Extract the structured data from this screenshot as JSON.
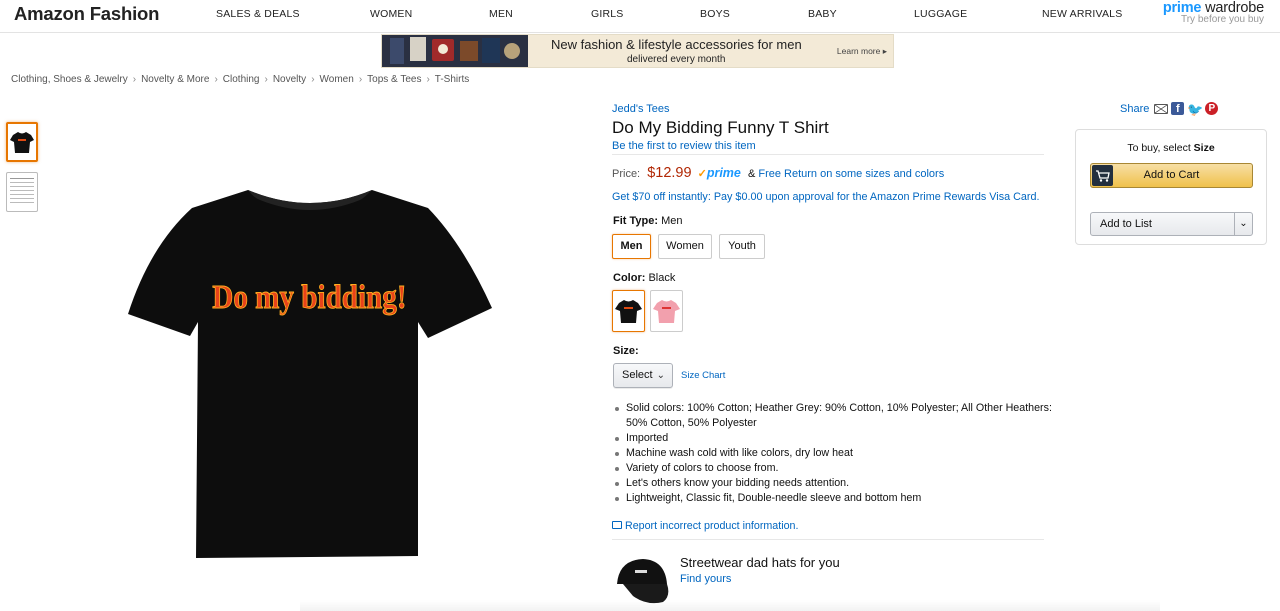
{
  "brand": "Amazon Fashion",
  "nav": {
    "items": [
      "SALES & DEALS",
      "WOMEN",
      "MEN",
      "GIRLS",
      "BOYS",
      "BABY",
      "LUGGAGE",
      "NEW ARRIVALS"
    ]
  },
  "prime_wardrobe": {
    "prime": "prime",
    "wardrobe": " wardrobe",
    "sub": "Try before you buy"
  },
  "banner": {
    "headline": "New fashion & lifestyle accessories for men",
    "sub": "delivered every month",
    "learn_more": "Learn more ▸"
  },
  "breadcrumb": [
    "Clothing, Shoes & Jewelry",
    "Novelty & More",
    "Clothing",
    "Novelty",
    "Women",
    "Tops & Tees",
    "T-Shirts"
  ],
  "breadcrumb_sep": "›",
  "product": {
    "byline": "Jedd's Tees",
    "title": "Do My Bidding Funny T Shirt",
    "review_link": "Be the first to review this item",
    "price_label": "Price:",
    "price": "$12.99",
    "prime_logo": "prime",
    "prime_check": "✓",
    "amp": "&",
    "free_return": "Free Return on some sizes and colors",
    "promo": "Get $70 off instantly: Pay $0.00 upon approval for the Amazon Prime Rewards Visa Card.",
    "shirt_print": "Do my bidding!"
  },
  "fit": {
    "label": "Fit Type:",
    "value": "Men",
    "options": [
      "Men",
      "Women",
      "Youth"
    ]
  },
  "color": {
    "label": "Color:",
    "value": "Black",
    "swatches": [
      "Black",
      "Pink"
    ]
  },
  "size": {
    "label": "Size:",
    "select": "Select",
    "chart": "Size Chart"
  },
  "bullets": [
    "Solid colors: 100% Cotton; Heather Grey: 90% Cotton, 10% Polyester; All Other Heathers: 50% Cotton, 50% Polyester",
    "Imported",
    "Machine wash cold with like colors, dry low heat",
    "Variety of colors to choose from.",
    "Let's others know your bidding needs attention.",
    "Lightweight, Classic fit, Double-needle sleeve and bottom hem"
  ],
  "report": "Report incorrect product information.",
  "promo_card": {
    "title": "Streetwear dad hats for you",
    "link": "Find yours"
  },
  "share": {
    "label": "Share"
  },
  "buybox": {
    "hint_prefix": "To buy, select ",
    "hint_bold": "Size",
    "add_to_cart": "Add to Cart",
    "add_to_list": "Add to List"
  },
  "colors": {
    "link": "#0066c0",
    "price": "#B12704",
    "accent": "#e77600",
    "prime_blue": "#1a98ff",
    "cart_button": "#f0c14b"
  }
}
